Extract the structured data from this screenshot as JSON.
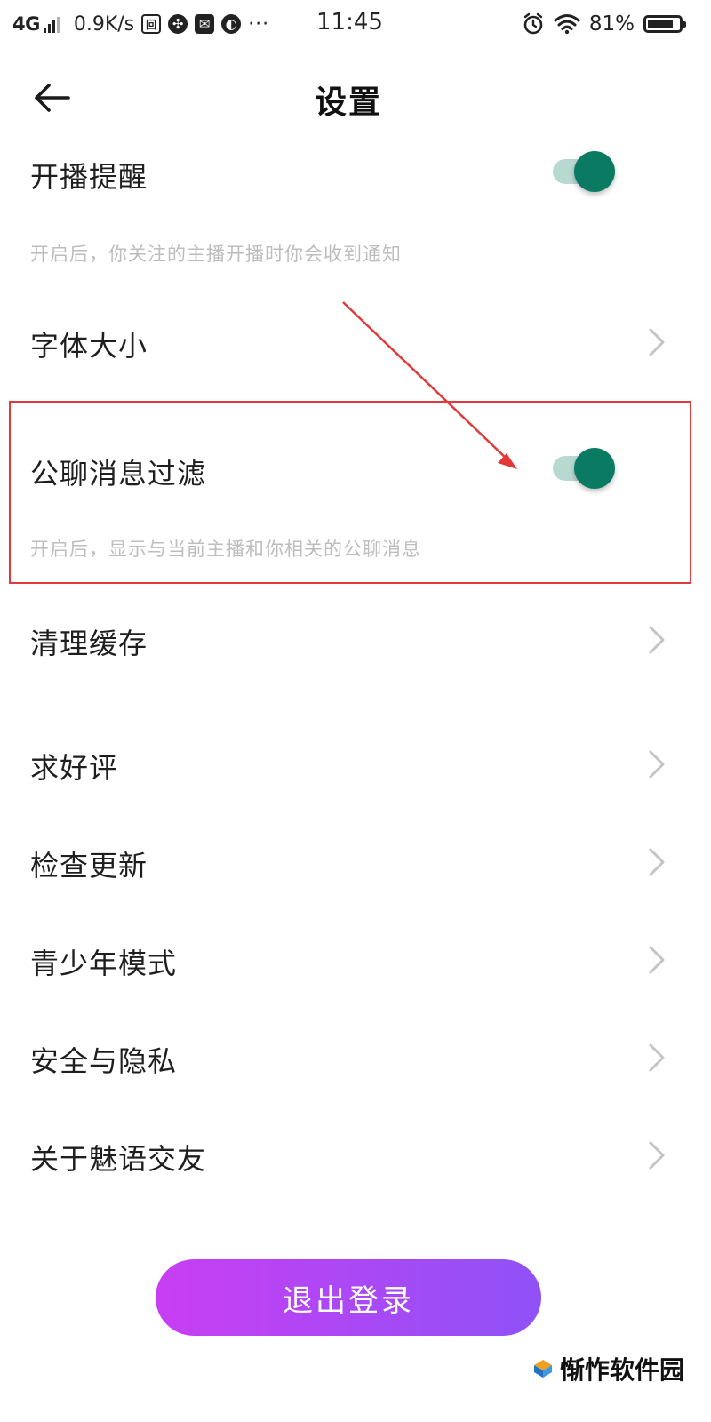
{
  "status_bar": {
    "network": "4G",
    "speed": "0.9K/s",
    "more": "···",
    "time": "11:45",
    "battery_pct": "81%",
    "battery_level": 0.81,
    "icons": [
      "signal-icon",
      "notification-app-icon",
      "fan-app-icon",
      "mail-app-icon",
      "browser-app-icon",
      "alarm-icon",
      "wifi-icon",
      "battery-icon"
    ]
  },
  "header": {
    "title": "设置"
  },
  "settings": [
    {
      "label": "开播提醒",
      "type": "toggle",
      "on": true,
      "desc": "开启后，你关注的主播开播时你会收到通知"
    },
    {
      "label": "字体大小",
      "type": "link"
    },
    {
      "label": "公聊消息过滤",
      "type": "toggle",
      "on": true,
      "desc": "开启后，显示与当前主播和你相关的公聊消息"
    },
    {
      "label": "清理缓存",
      "type": "link"
    },
    {
      "label": "求好评",
      "type": "link"
    },
    {
      "label": "检查更新",
      "type": "link"
    },
    {
      "label": "青少年模式",
      "type": "link"
    },
    {
      "label": "安全与隐私",
      "type": "link"
    },
    {
      "label": "关于魅语交友",
      "type": "link"
    }
  ],
  "logout": {
    "label": "退出登录"
  },
  "watermark": {
    "text": "惭怍软件园"
  },
  "colors": {
    "toggle_on": "#0b7a63",
    "toggle_track": "#b8d9d1",
    "annotation": "#e23a3a",
    "logout_gradient_start": "#c83ef2",
    "logout_gradient_end": "#8f52f7"
  }
}
